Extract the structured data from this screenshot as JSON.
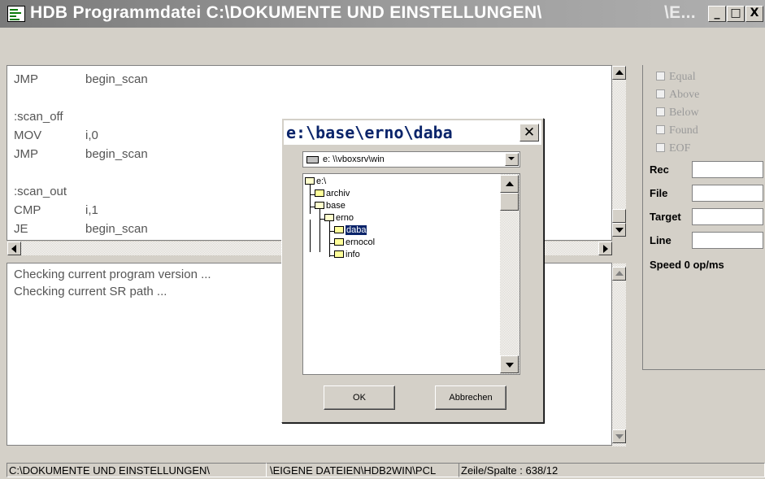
{
  "window": {
    "title": "HDB Programmdatei C:\\DOKUMENTE UND EINSTELLUNGEN\\",
    "title_tail": "\\E...",
    "controls": {
      "minimize": "_",
      "maximize": "□",
      "close": "X"
    }
  },
  "code": {
    "lines": [
      {
        "op": "JMP",
        "arg": "begin_scan"
      },
      {
        "op": "",
        "arg": ""
      },
      {
        "op": ":scan_off",
        "arg": ""
      },
      {
        "op": "MOV",
        "arg": "i,0"
      },
      {
        "op": "JMP",
        "arg": "begin_scan"
      },
      {
        "op": "",
        "arg": ""
      },
      {
        "op": ":scan_out",
        "arg": ""
      },
      {
        "op": "CMP",
        "arg": "i,1"
      },
      {
        "op": "JE",
        "arg": "begin_scan"
      }
    ]
  },
  "log": {
    "lines": [
      "Checking current program version ...",
      "Checking current SR path ..."
    ]
  },
  "right_panel": {
    "flags": [
      "Equal",
      "Above",
      "Below",
      "Found",
      "EOF"
    ],
    "fields": [
      {
        "label": "Rec",
        "value": ""
      },
      {
        "label": "File",
        "value": ""
      },
      {
        "label": "Target",
        "value": ""
      },
      {
        "label": "Line",
        "value": ""
      }
    ],
    "speed": "Speed 0 op/ms"
  },
  "statusbar": {
    "path": "C:\\DOKUMENTE UND EINSTELLUNGEN\\",
    "path2": "\\EIGENE DATEIEN\\HDB2WIN\\PCL",
    "position": "Zeile/Spalte : 638/12"
  },
  "dialog": {
    "title": "e:\\base\\erno\\daba",
    "close": "✕",
    "drive": "e: \\\\vboxsrv\\win",
    "tree": [
      {
        "label": "e:\\",
        "level": 0,
        "open": true
      },
      {
        "label": "archiv",
        "level": 1,
        "open": false
      },
      {
        "label": "base",
        "level": 1,
        "open": true
      },
      {
        "label": "erno",
        "level": 2,
        "open": true
      },
      {
        "label": "daba",
        "level": 3,
        "open": false,
        "selected": true
      },
      {
        "label": "ernocol",
        "level": 3,
        "open": false
      },
      {
        "label": "info",
        "level": 3,
        "open": false
      }
    ],
    "ok_label": "OK",
    "cancel_label": "Abbrechen"
  },
  "colors": {
    "selection": "#0a246a",
    "face": "#d4d0c8"
  }
}
